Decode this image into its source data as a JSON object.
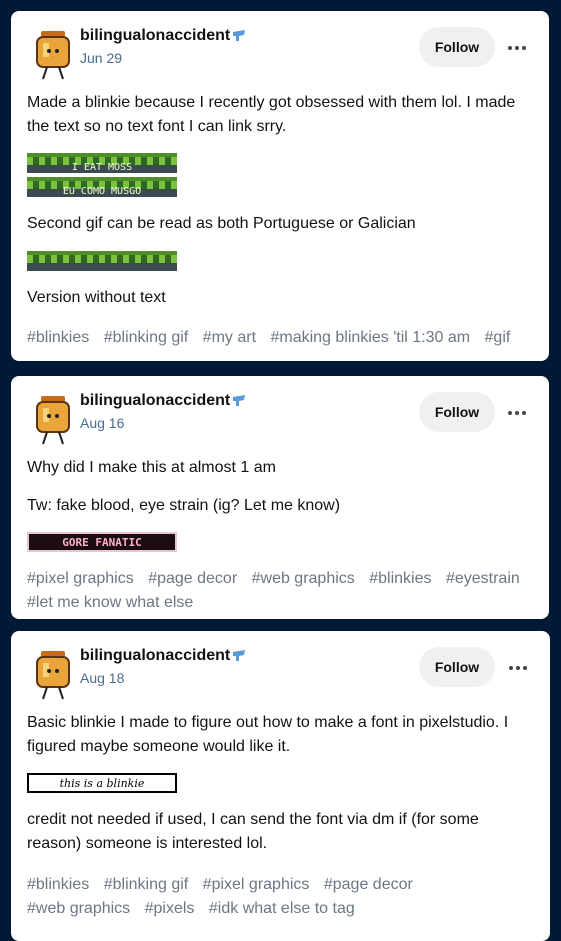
{
  "posts": [
    {
      "blog_name": "bilingualonaccident",
      "date": "Jun 29",
      "follow_label": "Follow",
      "paragraphs": [
        "Made a blinkie because I recently got obsessed with them lol. I made the text so no text font I can link srry.",
        "Second gif can be read as both Portuguese or Galician",
        "Version without text"
      ],
      "blinkies": [
        "I EAT MOSS",
        "EU COMO MUSGO"
      ],
      "tags": [
        "#blinkies",
        "#blinking gif",
        "#my art",
        "#making blinkies 'til 1:30 am",
        "#gif"
      ]
    },
    {
      "blog_name": "bilingualonaccident",
      "date": "Aug 16",
      "follow_label": "Follow",
      "paragraphs": [
        "Why did I make this at almost 1 am",
        "Tw: fake blood, eye strain (ig? Let me know)"
      ],
      "blinkies": [
        "GORE FANATIC"
      ],
      "tags": [
        "#pixel graphics",
        "#page decor",
        "#web graphics",
        "#blinkies",
        "#eyestrain",
        "#let me know what else"
      ]
    },
    {
      "blog_name": "bilingualonaccident",
      "date": "Aug 18",
      "follow_label": "Follow",
      "paragraphs": [
        "Basic blinkie I made to figure out how to make a font in pixelstudio. I figured maybe someone would like it.",
        "credit not needed if used, I can send the font via dm if (for some reason) someone is interested lol."
      ],
      "blinkies": [
        "this is a blinkie"
      ],
      "tags": [
        "#blinkies",
        "#blinking gif",
        "#pixel graphics",
        "#page decor",
        "#web graphics",
        "#pixels",
        "#idk what else to tag"
      ]
    }
  ],
  "colors": {
    "background": "#001935",
    "card": "#ffffff",
    "secondary_text": "#4a6b8a",
    "tag_text": "#6b7785",
    "follow_bg": "#f0f0f0",
    "verified_badge": "#5b9bd5"
  },
  "icons": [
    "avatar-jar-character",
    "verified-badge-icon",
    "more-options-icon"
  ]
}
